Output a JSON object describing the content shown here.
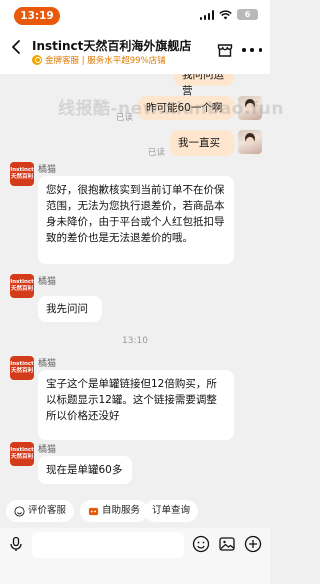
{
  "status_bar": {
    "time": "13:19",
    "battery": "6"
  },
  "header": {
    "shop_name": "Instinct天然百利海外旗舰店",
    "shop_sub": "金牌客服 | 服务水平超99%店铺"
  },
  "watermark": "线报酷-new.xianbao.fun",
  "messages": {
    "m1_text": "我问问运营",
    "m2_text": "昨可能60一个啊",
    "m2_read": "已读",
    "m3_text": "我一直买",
    "m3_read": "已读",
    "m4_sender": "橘猫",
    "m4_text": "您好，很抱歉核实到当前订单不在价保范围，无法为您执行退差价，若商品本身未降价，由于平台或个人红包抵扣导致的差价也是无法退差价的哦。",
    "m5_sender": "橘猫",
    "m5_text": "我先问问",
    "timestamp": "13:10",
    "m6_sender": "橘猫",
    "m6_text": "宝子这个是单罐链接但12倍购买，所以标题显示12罐。这个链接需要调整所以价格还没好",
    "m7_sender": "橘猫",
    "m7_text": "现在是单罐60多"
  },
  "shop_avatar": {
    "line1": "Instinct",
    "line2": "天然百利"
  },
  "quick_actions": [
    "评价客服",
    "自助服务",
    "订单查询"
  ],
  "icons": [
    "back-arrow-icon",
    "shop-icon",
    "more-icon",
    "microphone-icon",
    "emoji-icon",
    "image-icon",
    "plus-icon"
  ]
}
